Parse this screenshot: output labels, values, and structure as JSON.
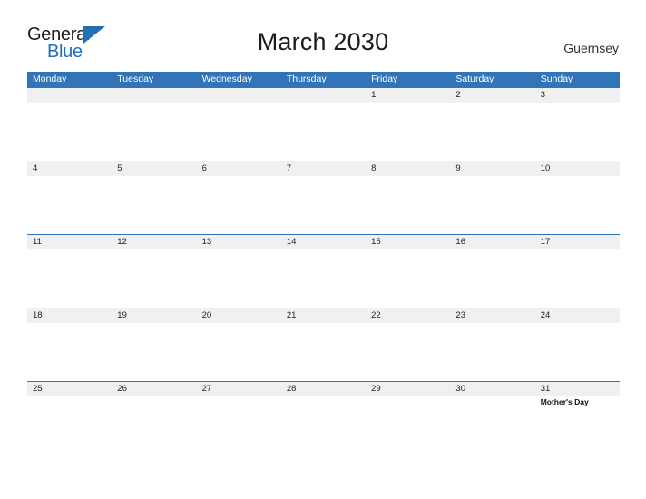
{
  "brand": {
    "logo_primary": "General",
    "logo_secondary": "Blue",
    "triangle_icon": "triangle-icon"
  },
  "header": {
    "title": "March 2030",
    "region": "Guernsey"
  },
  "colors": {
    "header_blue": "#3175b8",
    "row_band_gray": "#f0f0f0",
    "logo_blue": "#2070b8",
    "text_dark": "#1c1c1c",
    "page_background": "#ffffff"
  },
  "calendar": {
    "weekdays": [
      "Monday",
      "Tuesday",
      "Wednesday",
      "Thursday",
      "Friday",
      "Saturday",
      "Sunday"
    ],
    "weeks": [
      [
        {
          "day": "",
          "event": ""
        },
        {
          "day": "",
          "event": ""
        },
        {
          "day": "",
          "event": ""
        },
        {
          "day": "",
          "event": ""
        },
        {
          "day": "1",
          "event": ""
        },
        {
          "day": "2",
          "event": ""
        },
        {
          "day": "3",
          "event": ""
        }
      ],
      [
        {
          "day": "4",
          "event": ""
        },
        {
          "day": "5",
          "event": ""
        },
        {
          "day": "6",
          "event": ""
        },
        {
          "day": "7",
          "event": ""
        },
        {
          "day": "8",
          "event": ""
        },
        {
          "day": "9",
          "event": ""
        },
        {
          "day": "10",
          "event": ""
        }
      ],
      [
        {
          "day": "11",
          "event": ""
        },
        {
          "day": "12",
          "event": ""
        },
        {
          "day": "13",
          "event": ""
        },
        {
          "day": "14",
          "event": ""
        },
        {
          "day": "15",
          "event": ""
        },
        {
          "day": "16",
          "event": ""
        },
        {
          "day": "17",
          "event": ""
        }
      ],
      [
        {
          "day": "18",
          "event": ""
        },
        {
          "day": "19",
          "event": ""
        },
        {
          "day": "20",
          "event": ""
        },
        {
          "day": "21",
          "event": ""
        },
        {
          "day": "22",
          "event": ""
        },
        {
          "day": "23",
          "event": ""
        },
        {
          "day": "24",
          "event": ""
        }
      ],
      [
        {
          "day": "25",
          "event": ""
        },
        {
          "day": "26",
          "event": ""
        },
        {
          "day": "27",
          "event": ""
        },
        {
          "day": "28",
          "event": ""
        },
        {
          "day": "29",
          "event": ""
        },
        {
          "day": "30",
          "event": ""
        },
        {
          "day": "31",
          "event": "Mother's Day"
        }
      ]
    ]
  }
}
